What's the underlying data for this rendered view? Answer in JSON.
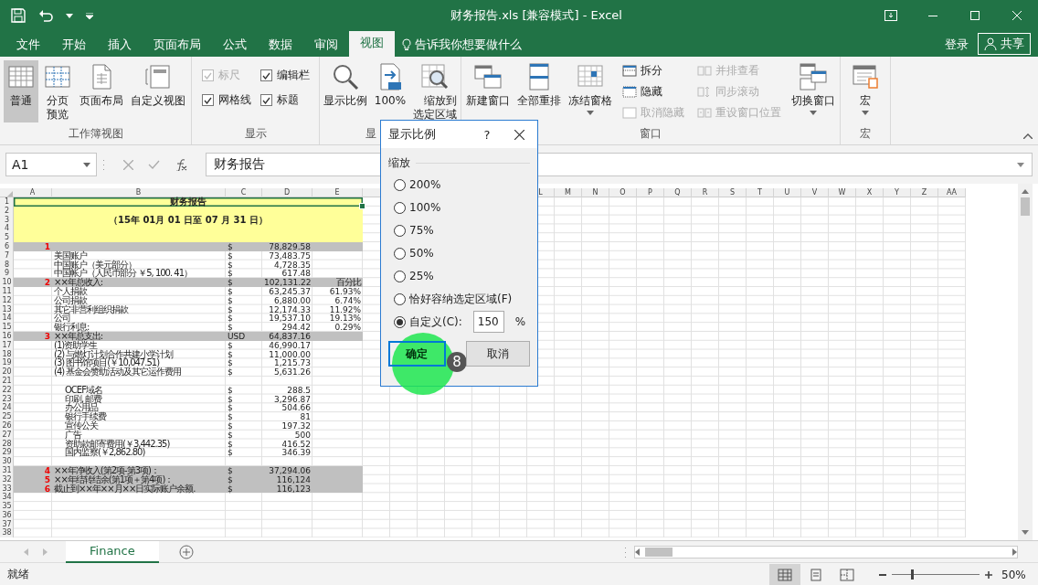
{
  "window": {
    "title": "财务报告.xls  [兼容模式] - Excel"
  },
  "menu_tabs": [
    {
      "label": "文件",
      "selected": false
    },
    {
      "label": "开始",
      "selected": false
    },
    {
      "label": "插入",
      "selected": false
    },
    {
      "label": "页面布局",
      "selected": false
    },
    {
      "label": "公式",
      "selected": false
    },
    {
      "label": "数据",
      "selected": false
    },
    {
      "label": "审阅",
      "selected": false
    },
    {
      "label": "视图",
      "selected": true
    }
  ],
  "tell_me": "告诉我你想要做什么",
  "account": {
    "sign_in": "登录",
    "share": "共享"
  },
  "ribbon": {
    "groups": [
      {
        "label": "工作簿视图",
        "items": [
          {
            "kind": "large",
            "label": "普通",
            "selected": true
          },
          {
            "kind": "large",
            "label": "分页预览",
            "two_line": true,
            "selected": false
          },
          {
            "kind": "large",
            "label": "页面布局",
            "selected": false
          },
          {
            "kind": "large",
            "label": "自定义视图",
            "selected": false
          }
        ]
      },
      {
        "label": "显示",
        "items": [
          {
            "kind": "check",
            "label": "标尺",
            "checked": true,
            "disabled": true
          },
          {
            "kind": "check",
            "label": "编辑栏",
            "checked": true,
            "disabled": false
          },
          {
            "kind": "check",
            "label": "网格线",
            "checked": true,
            "disabled": false
          },
          {
            "kind": "check",
            "label": "标题",
            "checked": true,
            "disabled": false
          }
        ]
      },
      {
        "label": "显",
        "items": [
          {
            "kind": "large",
            "label": "显示比例"
          },
          {
            "kind": "large",
            "label": "100%"
          },
          {
            "kind": "large",
            "label": "缩放到选定区域",
            "two_line": true
          }
        ]
      },
      {
        "label": "窗口",
        "items": [
          {
            "kind": "large",
            "label": "新建窗口"
          },
          {
            "kind": "large",
            "label": "全部重排"
          },
          {
            "kind": "large",
            "label": "冻结窗格",
            "dropdown": true
          },
          {
            "kind": "small",
            "label": "拆分",
            "disabled": false
          },
          {
            "kind": "small",
            "label": "隐藏",
            "disabled": false
          },
          {
            "kind": "small",
            "label": "取消隐藏",
            "disabled": true
          },
          {
            "kind": "small",
            "label": "并排查看",
            "disabled": true
          },
          {
            "kind": "small",
            "label": "同步滚动",
            "disabled": true
          },
          {
            "kind": "small",
            "label": "重设窗口位置",
            "disabled": true
          },
          {
            "kind": "large",
            "label": "切换窗口",
            "dropdown": true
          }
        ]
      },
      {
        "label": "宏",
        "items": [
          {
            "kind": "large",
            "label": "宏",
            "dropdown": true
          }
        ]
      }
    ]
  },
  "formula_bar": {
    "name_box": "A1",
    "formula": "财务报告"
  },
  "sheet": {
    "column_headers": [
      "A",
      "B",
      "C",
      "D",
      "E",
      "L",
      "M",
      "N",
      "O",
      "P",
      "Q",
      "R",
      "S",
      "T",
      "U",
      "V",
      "W",
      "X",
      "Y",
      "Z",
      "AA"
    ],
    "title_cell": "财务报告",
    "period_cell": "（15年  01月  01  日至  07  月  31  日）",
    "rows": [
      {
        "number": "1"
      },
      {
        "number": "2"
      },
      {
        "number": "3"
      },
      {
        "number": "4"
      },
      {
        "number": "5"
      },
      {
        "number": "6",
        "shaded": true,
        "cells": {
          "a": "1",
          "c": "$",
          "d": "78,829.58"
        }
      },
      {
        "number": "7",
        "cells": {
          "b": "美国账户",
          "c": "$",
          "d": "73,483.75"
        }
      },
      {
        "number": "8",
        "cells": {
          "b": "中国账户（美元部分）",
          "c": "$",
          "d": "4,728.35"
        }
      },
      {
        "number": "9",
        "cells": {
          "b": "中国帐户（人民币部分 ￥5, 100. 41）",
          "c": "$",
          "d": "617.48"
        }
      },
      {
        "number": "10",
        "shaded": true,
        "cells": {
          "a": "2",
          "b": "××年总收入:",
          "c": "$",
          "d": "102,131.22",
          "e": "百分比"
        }
      },
      {
        "number": "11",
        "cells": {
          "b": "个人捐款",
          "c": "$",
          "d": "63,245.37",
          "e": "61.93%"
        }
      },
      {
        "number": "12",
        "cells": {
          "b": "公司捐款",
          "c": "$",
          "d": "6,880.00",
          "e": "6.74%"
        }
      },
      {
        "number": "13",
        "cells": {
          "b": "其它非营利组织捐款",
          "c": "$",
          "d": "12,174.33",
          "e": "11.92%"
        }
      },
      {
        "number": "14",
        "cells": {
          "b": "公司",
          "c": "$",
          "d": "19,537.10",
          "e": "19.13%"
        }
      },
      {
        "number": "15",
        "cells": {
          "b": "银行利息:",
          "c": "$",
          "d": "294.42",
          "e": "0.29%"
        }
      },
      {
        "number": "16",
        "shaded": true,
        "cells": {
          "a": "3",
          "b": "××年总支出:",
          "c": "USD",
          "d": "64,837.16"
        }
      },
      {
        "number": "17",
        "cells": {
          "b": "(1)资助学生",
          "c": "$",
          "d": "46,990.17"
        }
      },
      {
        "number": "18",
        "cells": {
          "b": "(2) 与燃灯计划合作共建小学计划",
          "c": "$",
          "d": "11,000.00"
        }
      },
      {
        "number": "19",
        "cells": {
          "b": "(3) 图书馆项目(￥10,047.51)",
          "c": "$",
          "d": "1,215.73"
        }
      },
      {
        "number": "20",
        "cells": {
          "b": "(4) 基金会赞助活动及其它运作费用",
          "c": "$",
          "d": "5,631.26"
        }
      },
      {
        "number": "21"
      },
      {
        "number": "22",
        "indented": true,
        "cells": {
          "b": "OCEF域名",
          "c": "$",
          "d": "288.5"
        }
      },
      {
        "number": "23",
        "indented": true,
        "cells": {
          "b": "印刷, 邮费",
          "c": "$",
          "d": "3,296.87"
        }
      },
      {
        "number": "24",
        "indented": true,
        "cells": {
          "b": "办公用品",
          "c": "$",
          "d": "504.66"
        }
      },
      {
        "number": "25",
        "indented": true,
        "cells": {
          "b": "银行手续费",
          "c": "$",
          "d": "81"
        }
      },
      {
        "number": "26",
        "indented": true,
        "cells": {
          "b": "宣传公关",
          "c": "$",
          "d": "197.32"
        }
      },
      {
        "number": "27",
        "indented": true,
        "cells": {
          "b": "广告",
          "c": "$",
          "d": "500"
        }
      },
      {
        "number": "28",
        "indented": true,
        "cells": {
          "b": "资助款邮寄费用(￥3,442.35)",
          "c": "$",
          "d": "416.52"
        }
      },
      {
        "number": "29",
        "indented": true,
        "cells": {
          "b": "国内监察(￥2,862.80)",
          "c": "$",
          "d": "346.39"
        }
      },
      {
        "number": "30"
      },
      {
        "number": "31",
        "shaded": true,
        "cells": {
          "a": "4",
          "b": "××年净收入(第2项-第3项)：",
          "c": "$",
          "d": "37,294.06"
        }
      },
      {
        "number": "32",
        "shaded": true,
        "cells": {
          "a": "5",
          "b": "××年结转结余(第1项＋第4项)：",
          "c": "$",
          "d": "116,124"
        }
      },
      {
        "number": "33",
        "shaded": true,
        "cells": {
          "a": "6",
          "b": "截止到××年××月××日实际账户余额.",
          "c": "$",
          "d": "116,123"
        }
      },
      {
        "number": "34"
      },
      {
        "number": "35"
      },
      {
        "number": "36"
      },
      {
        "number": "37"
      },
      {
        "number": "38"
      }
    ]
  },
  "sheet_tabs": [
    {
      "label": "Finance",
      "selected": true
    }
  ],
  "status_bar": {
    "status": "就绪",
    "view_buttons": [
      {
        "selected": true
      },
      {
        "selected": false
      },
      {
        "selected": false
      }
    ],
    "zoom": {
      "level": 0.22,
      "reading": "50%"
    }
  },
  "zoom_dialog": {
    "title": "显示比例",
    "help": "?",
    "section": "缩放",
    "options": [
      {
        "label": "200%",
        "selected": false
      },
      {
        "label": "100%",
        "selected": false
      },
      {
        "label": "75%",
        "selected": false
      },
      {
        "label": "50%",
        "selected": false
      },
      {
        "label": "25%",
        "selected": false
      },
      {
        "label": "恰好容纳选定区域(F)",
        "selected": false
      },
      {
        "label": "自定义(C):",
        "selected": true
      }
    ],
    "custom_value": "150",
    "unit": "%",
    "buttons": [
      "确定",
      "取消"
    ]
  },
  "step_marker": {
    "number": "8"
  }
}
